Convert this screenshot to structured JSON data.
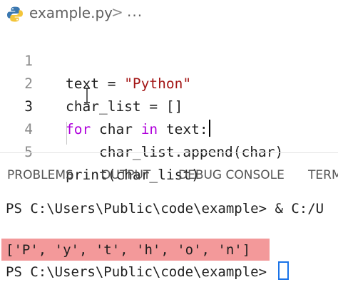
{
  "breadcrumb": {
    "file_name": "example.py",
    "separator": ">",
    "overflow": "...",
    "icon": "python-icon"
  },
  "editor": {
    "active_line": 3,
    "lines": [
      {
        "number": "1",
        "tokens": [
          {
            "t": "text = ",
            "c": "plain"
          },
          {
            "t": "\"Python\"",
            "c": "string"
          }
        ]
      },
      {
        "number": "2",
        "tokens": [
          {
            "t": "char_list = []",
            "c": "plain"
          }
        ]
      },
      {
        "number": "3",
        "tokens": [
          {
            "t": "for",
            "c": "keyword"
          },
          {
            "t": " char ",
            "c": "plain"
          },
          {
            "t": "in",
            "c": "keyword"
          },
          {
            "t": " text:",
            "c": "plain"
          }
        ]
      },
      {
        "number": "4",
        "tokens": [
          {
            "t": "    char_list.append(char)",
            "c": "plain"
          }
        ]
      },
      {
        "number": "5",
        "tokens": [
          {
            "t": "print(char_list)",
            "c": "plain"
          }
        ]
      }
    ]
  },
  "panel": {
    "tabs": [
      "PROBLEMS",
      "OUTPUT",
      "DEBUG CONSOLE",
      "TERM"
    ]
  },
  "terminal": {
    "lines": [
      "PS C:\\Users\\Public\\code\\example> & C:/U",
      "['P', 'y', 't', 'h', 'o', 'n']",
      "PS C:\\Users\\Public\\code\\example> "
    ],
    "highlight_color": "#f3999a"
  },
  "colors": {
    "keyword": "#af00db",
    "string": "#a31515",
    "line_number": "#8b8b8b",
    "cursor_blue": "#1a73e8"
  }
}
